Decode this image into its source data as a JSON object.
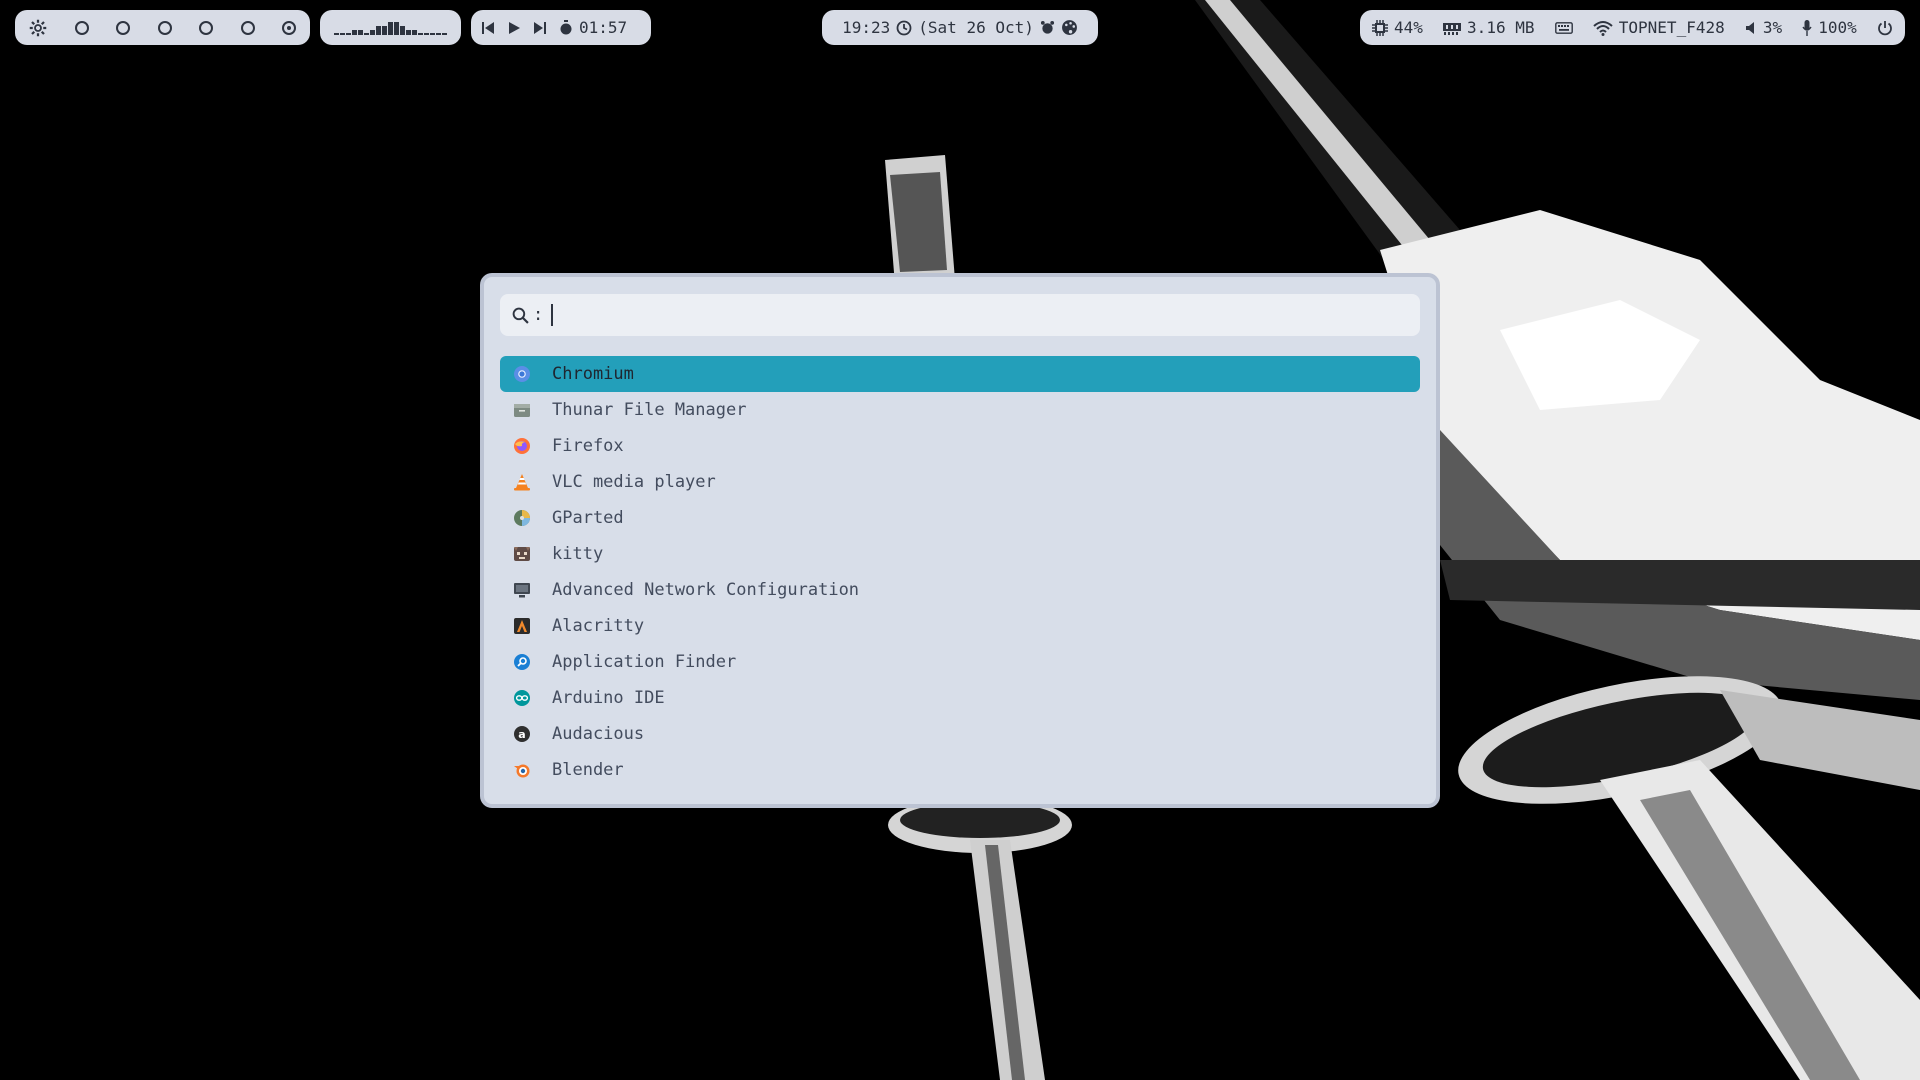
{
  "topbar": {
    "workspaces": {
      "icon": "settings-gear-icon",
      "dots": [
        "empty",
        "empty",
        "empty",
        "empty",
        "empty",
        "active"
      ]
    },
    "media": {
      "time": "01:57"
    },
    "clock": {
      "time": "19:23",
      "date": "(Sat 26 Oct)"
    },
    "status": {
      "cpu": "44%",
      "memory": "3.16 MB",
      "wifi": "TOPNET_F428",
      "volume": "3%",
      "mic": "100%"
    }
  },
  "launcher": {
    "search_prefix": ":",
    "search_value": "",
    "items": [
      {
        "label": "Chromium",
        "icon": "chromium-icon",
        "selected": true
      },
      {
        "label": "Thunar File Manager",
        "icon": "file-manager-icon"
      },
      {
        "label": "Firefox",
        "icon": "firefox-icon"
      },
      {
        "label": "VLC media player",
        "icon": "vlc-icon"
      },
      {
        "label": "GParted",
        "icon": "gparted-icon"
      },
      {
        "label": "kitty",
        "icon": "kitty-icon"
      },
      {
        "label": "Advanced Network Configuration",
        "icon": "network-icon"
      },
      {
        "label": "Alacritty",
        "icon": "alacritty-icon"
      },
      {
        "label": "Application Finder",
        "icon": "app-finder-icon"
      },
      {
        "label": "Arduino IDE",
        "icon": "arduino-icon"
      },
      {
        "label": "Audacious",
        "icon": "audacious-icon"
      },
      {
        "label": "Blender",
        "icon": "blender-icon"
      }
    ]
  },
  "colors": {
    "accent": "#239fba",
    "panel": "#d8dee9",
    "bar": "#d8dce6",
    "text": "#2e3440"
  }
}
